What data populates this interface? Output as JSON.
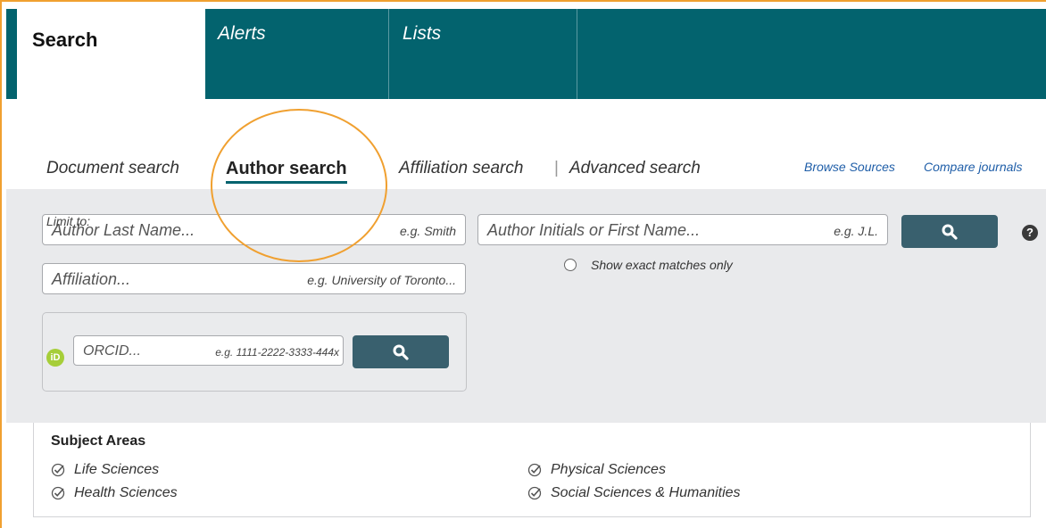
{
  "topnav": {
    "tabs": [
      {
        "label": "Search",
        "active": true
      },
      {
        "label": "Alerts",
        "active": false
      },
      {
        "label": "Lists",
        "active": false
      }
    ]
  },
  "search_types": {
    "document": "Document search",
    "author": "Author search",
    "affiliation": "Affiliation search",
    "separator": "|",
    "advanced": "Advanced search"
  },
  "links": {
    "browse_sources": "Browse Sources",
    "compare_journals": "Compare journals"
  },
  "form": {
    "last_name": {
      "placeholder": "Author Last Name...",
      "example": "e.g. Smith"
    },
    "initials": {
      "placeholder": "Author Initials or First Name...",
      "example": "e.g. J.L."
    },
    "affiliation": {
      "placeholder": "Affiliation...",
      "example": "e.g. University of Toronto..."
    },
    "orcid": {
      "placeholder": "ORCID...",
      "example": "e.g. 1111-2222-3333-444x",
      "icon_text": "iD"
    },
    "exact_matches": "Show exact matches only",
    "help": "?",
    "limit_to": "Limit to:"
  },
  "subject_areas": {
    "title": "Subject Areas",
    "items": [
      {
        "label": "Life Sciences",
        "checked": true
      },
      {
        "label": "Health Sciences",
        "checked": true
      },
      {
        "label": "Physical Sciences",
        "checked": true
      },
      {
        "label": "Social Sciences & Humanities",
        "checked": true
      }
    ]
  },
  "colors": {
    "nav_bg": "#03636e",
    "button_bg": "#39606e",
    "highlight": "#f0a030",
    "link": "#1f5ea8",
    "orcid_green": "#a6ce39"
  },
  "icons": {
    "search_button": "search-icon",
    "help": "help-icon",
    "orcid": "orcid-icon",
    "checkbox": "checkmark-circle-icon"
  }
}
